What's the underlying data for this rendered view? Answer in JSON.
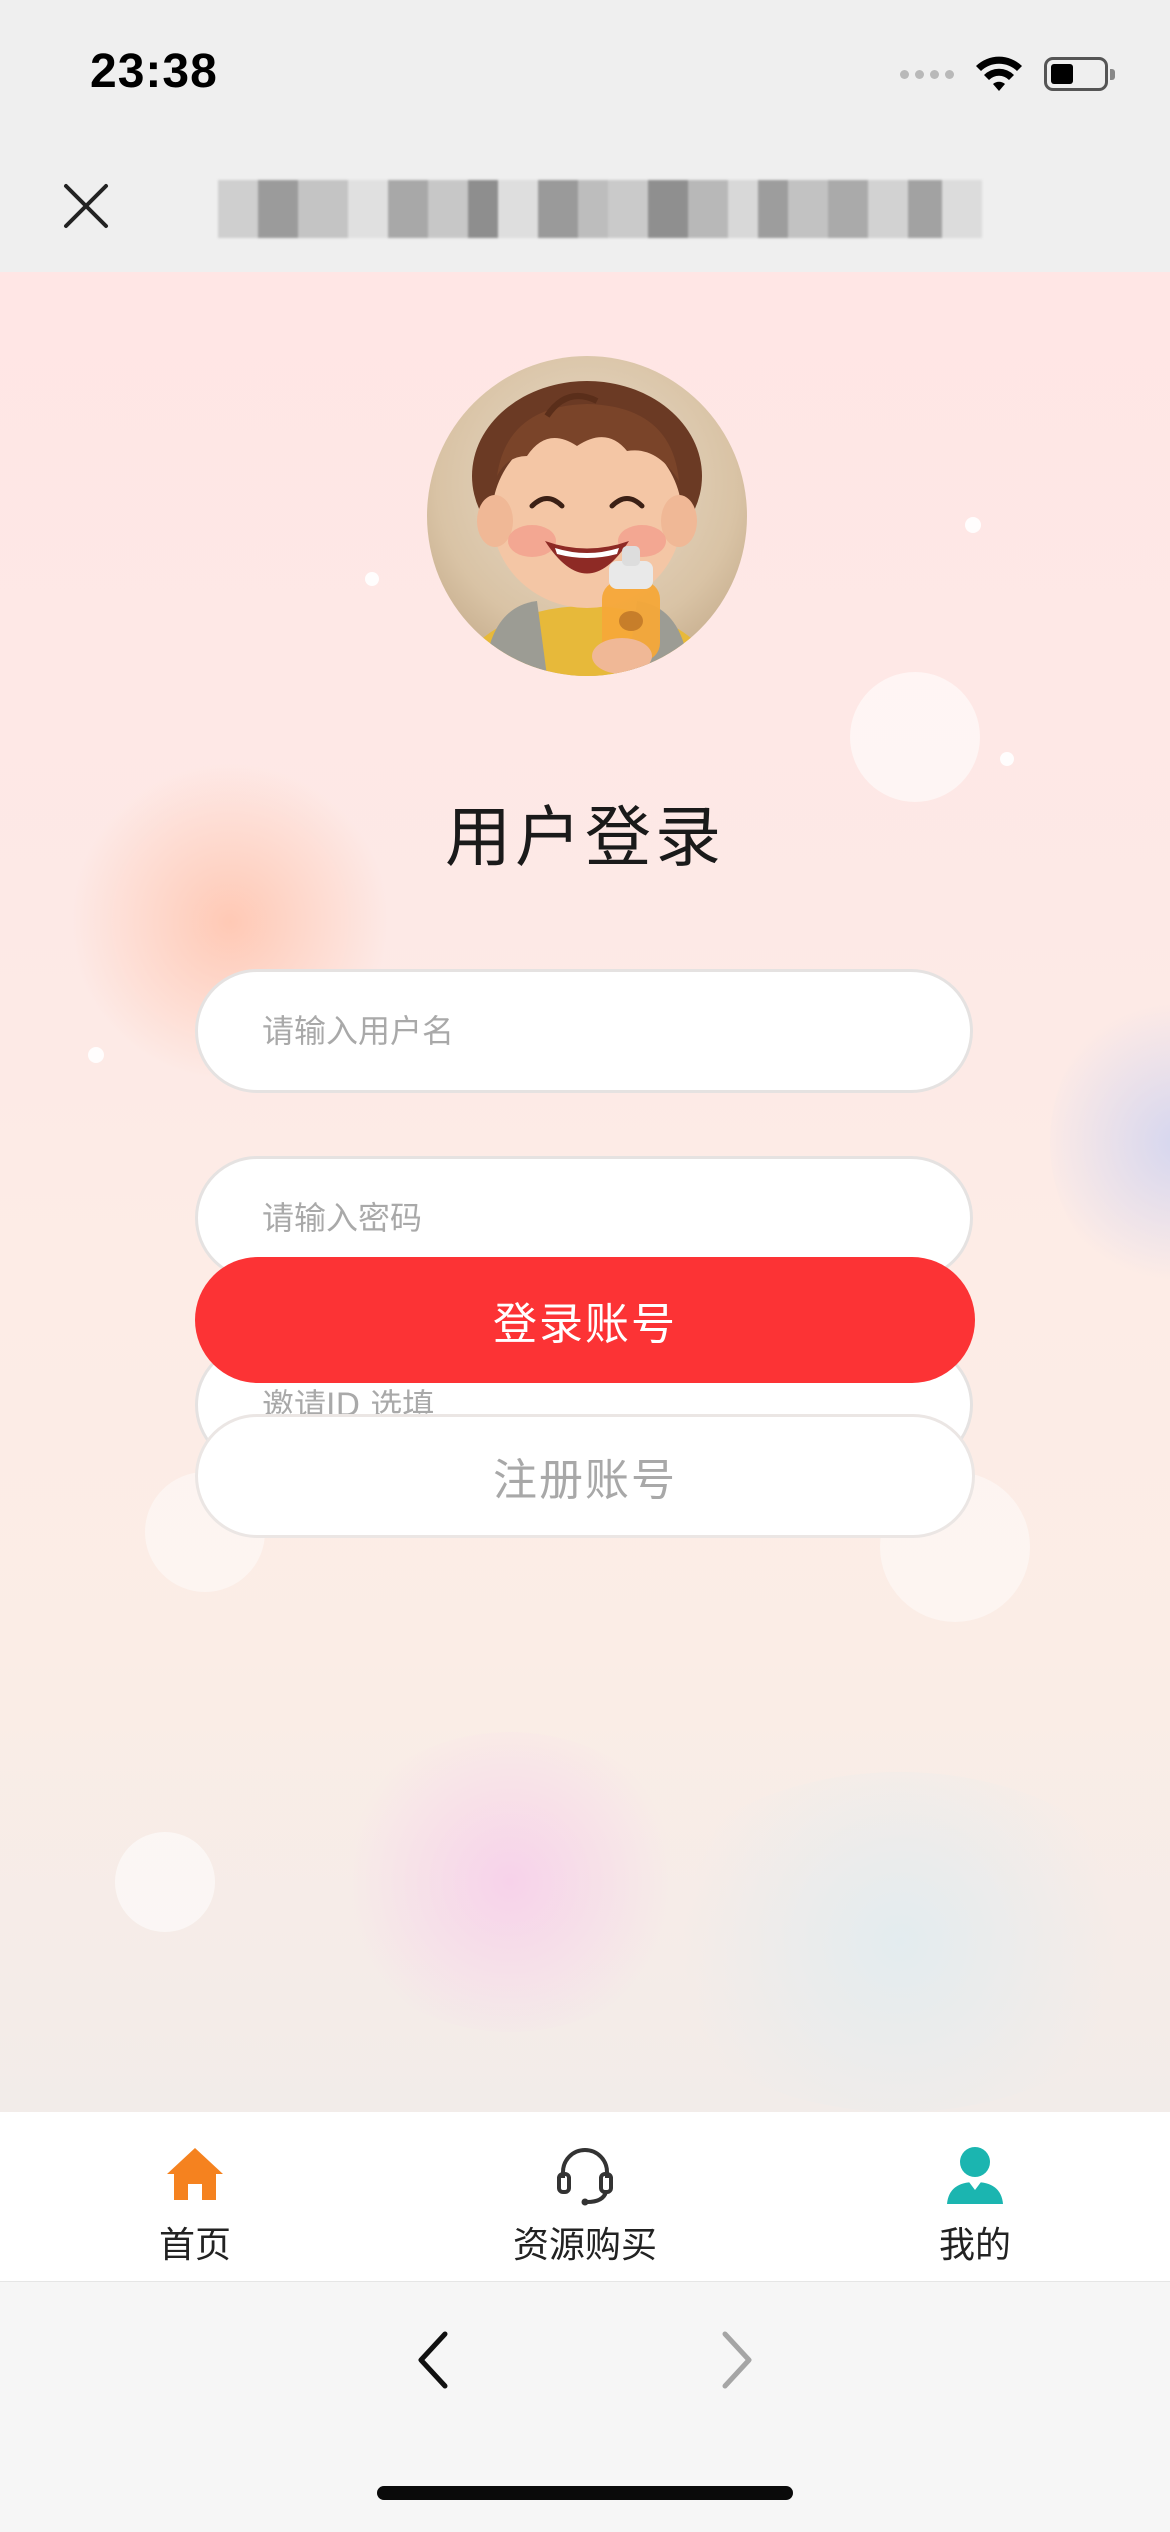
{
  "status_bar": {
    "time": "23:38",
    "icons": [
      "signal-icon",
      "wifi-icon",
      "battery-icon"
    ]
  },
  "nav_bar": {
    "close_icon": "close-icon",
    "title_obscured": true
  },
  "login": {
    "title": "用户登录",
    "username_placeholder": "请输入用户名",
    "password_placeholder": "请输入密码",
    "invite_placeholder": "邀请ID 选填",
    "login_button": "登录账号",
    "register_button": "注册账号"
  },
  "tab_bar": {
    "items": [
      {
        "label": "首页",
        "icon": "home-icon",
        "color": "#f5821f"
      },
      {
        "label": "资源购买",
        "icon": "headset-icon",
        "color": "#333333"
      },
      {
        "label": "我的",
        "icon": "user-icon",
        "color": "#1bb5b0"
      }
    ]
  },
  "colors": {
    "accent": "#fc3335",
    "home_active": "#f5821f",
    "profile": "#1bb5b0"
  }
}
